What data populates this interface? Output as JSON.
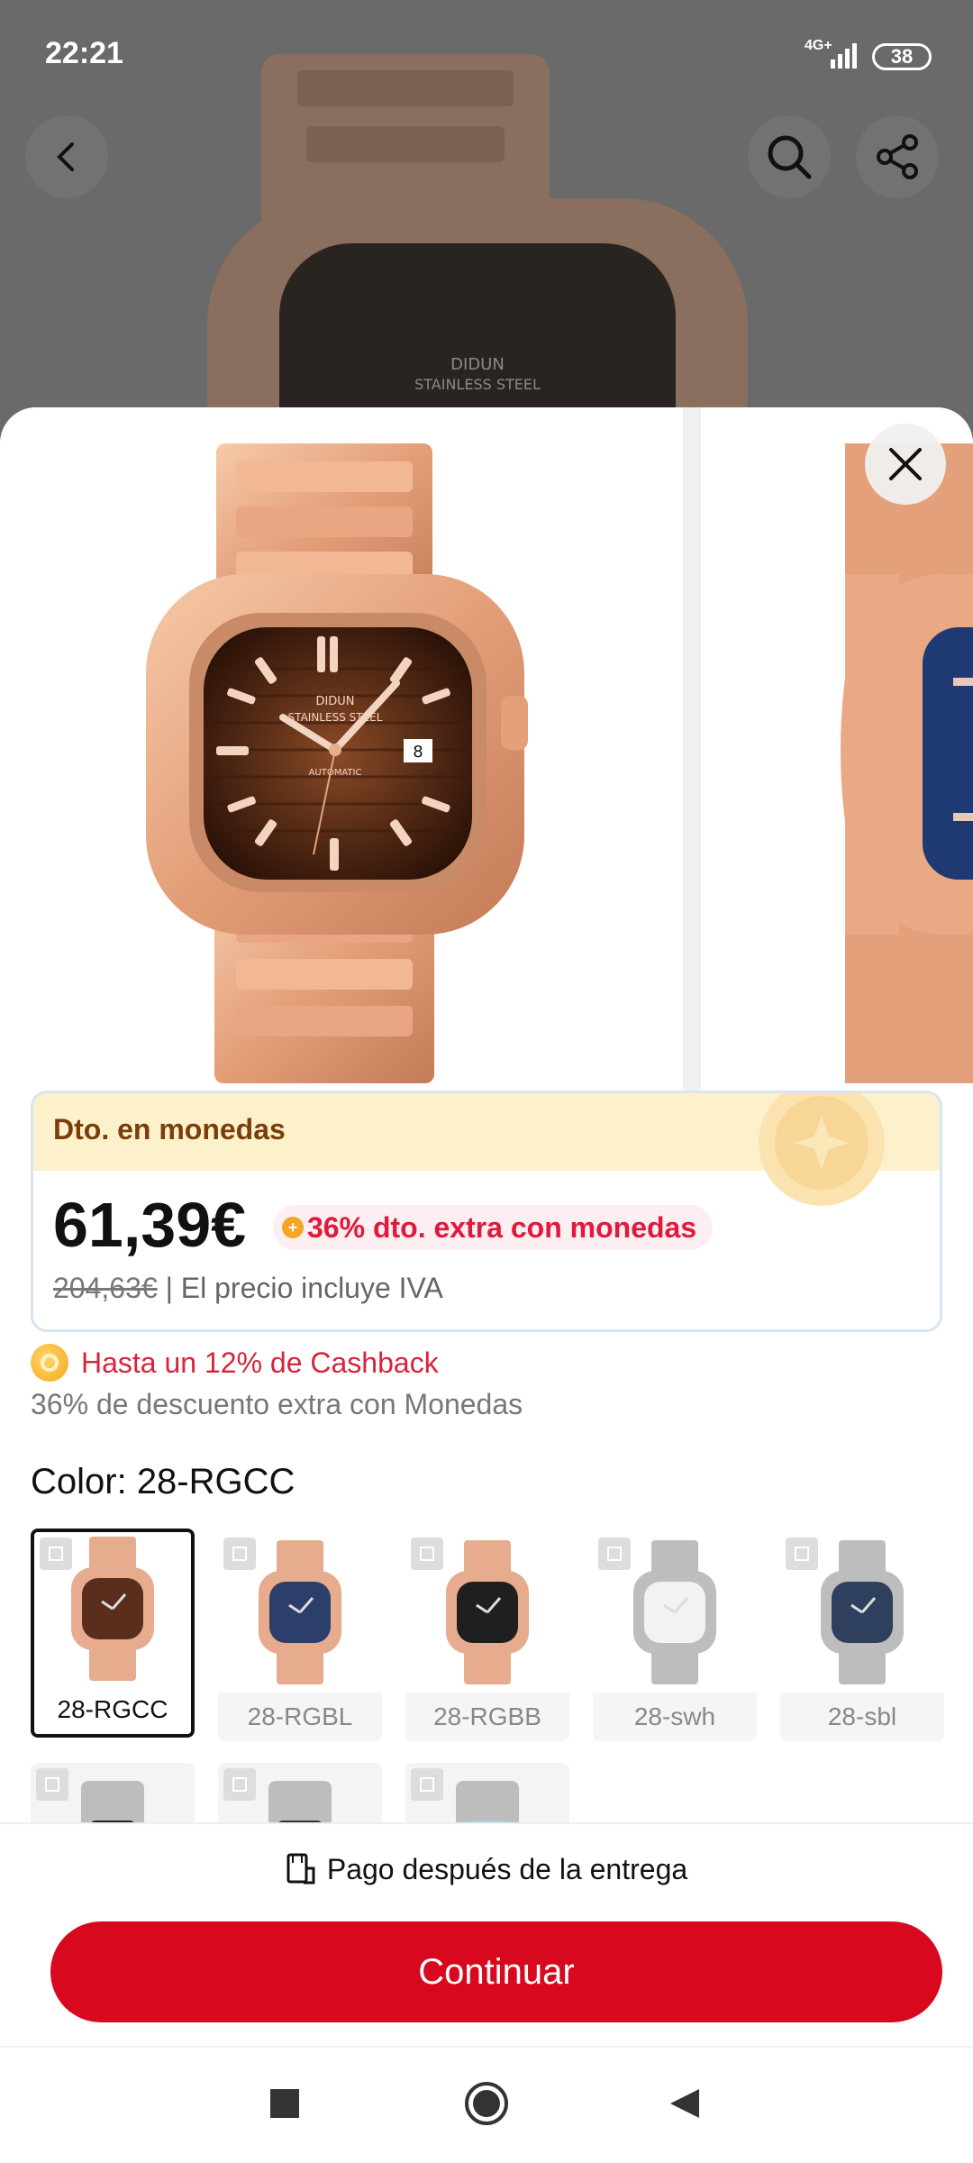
{
  "status_bar": {
    "time": "22:21",
    "network": "4G+",
    "battery": "38"
  },
  "price_card": {
    "header": "Dto. en monedas",
    "price": "61,39€",
    "coin_promo": "36% dto. extra con monedas",
    "old_price": "204,63€",
    "vat_note": " | El precio incluye IVA"
  },
  "cashback": "Hasta un 12% de Cashback",
  "extra_discount": "36% de descuento extra con Monedas",
  "color": {
    "label": "Color: 28-RGCC"
  },
  "swatches": [
    {
      "label": "28-RGCC",
      "case": "#e7ab8e",
      "dial": "#5a2e1c"
    },
    {
      "label": "28-RGBL",
      "case": "#e7ab8e",
      "dial": "#2c3f6a"
    },
    {
      "label": "28-RGBB",
      "case": "#e7ab8e",
      "dial": "#1f1f1f"
    },
    {
      "label": "28-swh",
      "case": "#bdbdbd",
      "dial": "#f2f2f2"
    },
    {
      "label": "28-sbl",
      "case": "#bdbdbd",
      "dial": "#2f3f5e"
    }
  ],
  "cod_label": "Pago después de la entrega",
  "continue_label": "Continuar",
  "watch": {
    "brand": "DIDUN",
    "subtitle": "STAINLESS STEEL",
    "movement": "AUTOMATIC",
    "date": "8"
  },
  "icons": [
    "back-icon",
    "search-icon",
    "share-icon",
    "close-icon",
    "coin-icon",
    "zoom-icon",
    "cod-icon",
    "nav-square-icon",
    "nav-home-icon",
    "nav-back-icon"
  ]
}
